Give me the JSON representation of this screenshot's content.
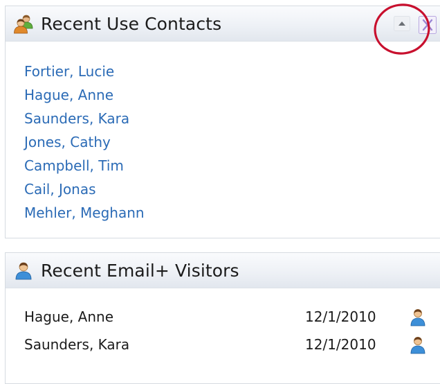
{
  "recent_contacts": {
    "title": "Recent Use Contacts",
    "header_icon": "contacts-group-icon",
    "collapse_icon": "collapse-up-icon",
    "close_icon": "close-icon",
    "contacts": [
      {
        "name": "Fortier, Lucie"
      },
      {
        "name": "Hague, Anne"
      },
      {
        "name": "Saunders, Kara"
      },
      {
        "name": "Jones, Cathy"
      },
      {
        "name": "Campbell, Tim"
      },
      {
        "name": "Cail, Jonas"
      },
      {
        "name": "Mehler, Meghann"
      }
    ]
  },
  "recent_visitors": {
    "title": "Recent Email+ Visitors",
    "header_icon": "person-icon",
    "visitors": [
      {
        "name": "Hague, Anne",
        "date": "12/1/2010",
        "icon": "person-icon"
      },
      {
        "name": "Saunders, Kara",
        "date": "12/1/2010",
        "icon": "person-icon"
      }
    ]
  },
  "colors": {
    "link": "#2b6bb6",
    "highlight_ring": "#c8102e",
    "header_gradient_top": "#fafbfd",
    "header_gradient_bottom": "#e2e7ee",
    "panel_border": "#d6dbe1"
  }
}
